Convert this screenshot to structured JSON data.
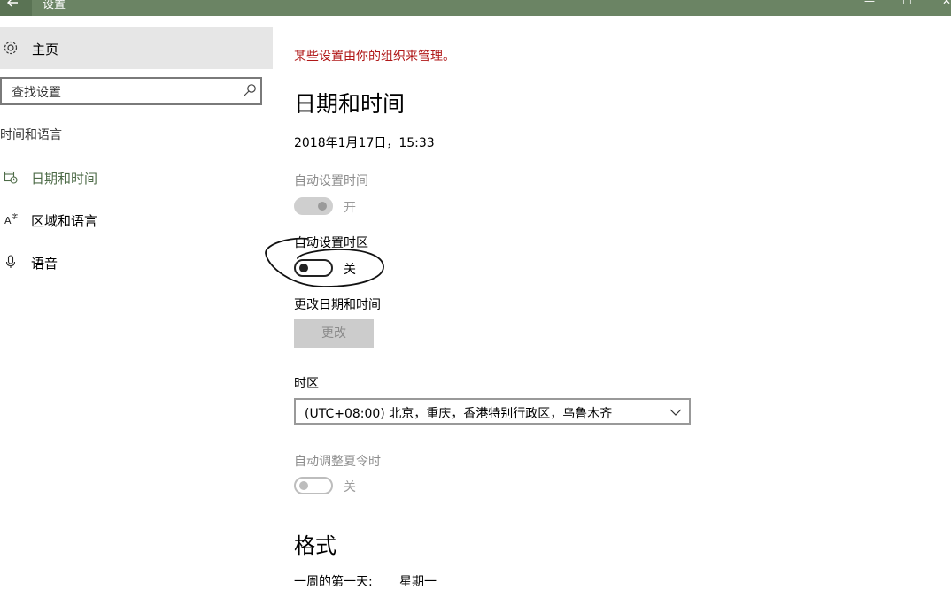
{
  "window": {
    "title": "设置",
    "controls": {
      "minimize": "—",
      "maximize": "☐",
      "close": "✕"
    }
  },
  "sidebar": {
    "home_label": "主页",
    "search_placeholder": "查找设置",
    "section_title": "时间和语言",
    "items": [
      {
        "label": "日期和时间",
        "icon": "calendar-clock-icon",
        "active": true
      },
      {
        "label": "区域和语言",
        "icon": "language-icon",
        "active": false
      },
      {
        "label": "语音",
        "icon": "microphone-icon",
        "active": false
      }
    ]
  },
  "main": {
    "managed_notice": "某些设置由你的组织来管理。",
    "heading": "日期和时间",
    "current_datetime": "2018年1月17日，15:33",
    "auto_time": {
      "label": "自动设置时间",
      "state_text": "开"
    },
    "auto_timezone": {
      "label": "自动设置时区",
      "state_text": "关"
    },
    "change_datetime": {
      "label": "更改日期和时间",
      "button": "更改"
    },
    "timezone": {
      "label": "时区",
      "value": "(UTC+08:00) 北京，重庆，香港特别行政区，乌鲁木齐"
    },
    "dst": {
      "label": "自动调整夏令时",
      "state_text": "关"
    },
    "format_heading": "格式",
    "first_day": {
      "label": "一周的第一天:",
      "value": "星期一"
    }
  },
  "colors": {
    "titlebar": "#6b8464",
    "accent": "#4d6b47",
    "managed_text": "#b01818"
  }
}
